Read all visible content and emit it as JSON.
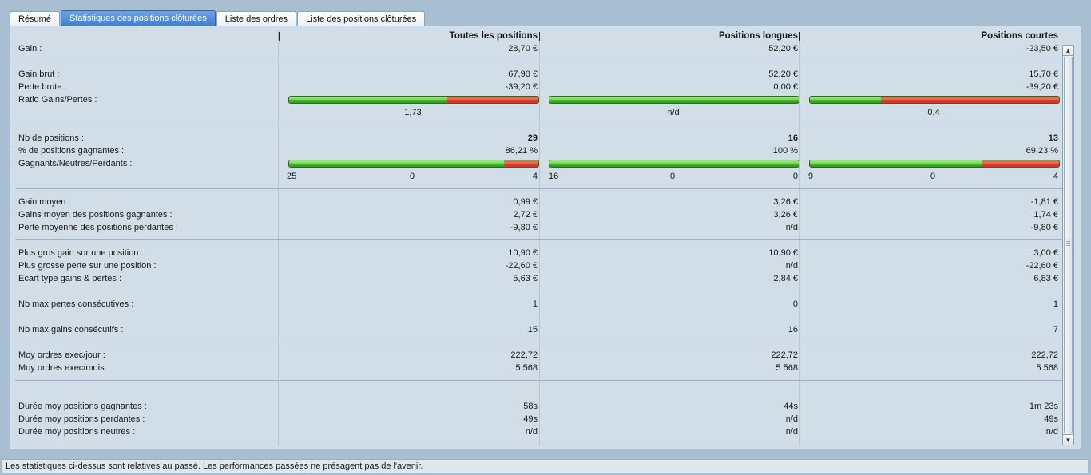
{
  "tabs": [
    {
      "label": "Résumé",
      "active": false
    },
    {
      "label": "Statistiques des positions clôturées",
      "active": true
    },
    {
      "label": "Liste des ordres",
      "active": false
    },
    {
      "label": "Liste des positions clôturées",
      "active": false
    }
  ],
  "columns": [
    "Toutes les positions",
    "Positions longues",
    "Positions courtes"
  ],
  "rows": {
    "gain": {
      "label": "Gain :",
      "v": [
        "28,70 €",
        "52,20 €",
        "-23,50 €"
      ]
    },
    "gain_brut": {
      "label": "Gain brut :",
      "v": [
        "67,90 €",
        "52,20 €",
        "15,70 €"
      ]
    },
    "perte_brute": {
      "label": "Perte brute :",
      "v": [
        "-39,20 €",
        "0,00 €",
        "-39,20 €"
      ]
    },
    "ratio": {
      "label": "Ratio Gains/Pertes :",
      "v": [
        "1,73",
        "n/d",
        "0,4"
      ]
    },
    "nb_positions": {
      "label": "Nb de positions :",
      "v": [
        "29",
        "16",
        "13"
      ]
    },
    "pct_gagnantes": {
      "label": "% de positions gagnantes :",
      "v": [
        "86,21 %",
        "100 %",
        "69,23 %"
      ]
    },
    "gnp": {
      "label": "Gagnants/Neutres/Perdants :",
      "counts": [
        {
          "g": "25",
          "n": "0",
          "p": "4"
        },
        {
          "g": "16",
          "n": "0",
          "p": "0"
        },
        {
          "g": "9",
          "n": "0",
          "p": "4"
        }
      ]
    },
    "gain_moyen": {
      "label": "Gain moyen :",
      "v": [
        "0,99 €",
        "3,26 €",
        "-1,81 €"
      ]
    },
    "gains_moy_gagnantes": {
      "label": "Gains moyen des positions gagnantes :",
      "v": [
        "2,72 €",
        "3,26 €",
        "1,74 €"
      ]
    },
    "perte_moy_perdantes": {
      "label": "Perte moyenne des positions perdantes :",
      "v": [
        "-9,80 €",
        "n/d",
        "-9,80 €"
      ]
    },
    "plus_gros_gain": {
      "label": "Plus gros gain sur une position :",
      "v": [
        "10,90 €",
        "10,90 €",
        "3,00 €"
      ]
    },
    "plus_grosse_perte": {
      "label": "Plus grosse perte sur une position :",
      "v": [
        "-22,60 €",
        "n/d",
        "-22,60 €"
      ]
    },
    "ecart_type": {
      "label": "Ecart type gains & pertes :",
      "v": [
        "5,63 €",
        "2,84 €",
        "6,83 €"
      ]
    },
    "max_pertes_consec": {
      "label": "Nb max pertes consécutives :",
      "v": [
        "1",
        "0",
        "1"
      ]
    },
    "max_gains_consec": {
      "label": "Nb max gains consécutifs :",
      "v": [
        "15",
        "16",
        "7"
      ]
    },
    "moy_ordres_jour": {
      "label": "Moy ordres exec/jour :",
      "v": [
        "222,72",
        "222,72",
        "222,72"
      ]
    },
    "moy_ordres_mois": {
      "label": "Moy ordres exec/mois",
      "v": [
        "5 568",
        "5 568",
        "5 568"
      ]
    },
    "duree_gagnantes": {
      "label": "Durée moy positions gagnantes :",
      "v": [
        "58s",
        "44s",
        "1m 23s"
      ]
    },
    "duree_perdantes": {
      "label": "Durée moy positions perdantes :",
      "v": [
        "49s",
        "n/d",
        "49s"
      ]
    },
    "duree_neutres": {
      "label": "Durée moy positions neutres :",
      "v": [
        "n/d",
        "n/d",
        "n/d"
      ]
    }
  },
  "bars": {
    "ratio_green_fraction": [
      0.634,
      1.0,
      0.286
    ],
    "gnp_green_fraction": [
      0.862,
      1.0,
      0.692
    ]
  },
  "colors": {
    "win": "#3fbf22",
    "loss": "#d63a22",
    "tab_active": "#3f7ed1"
  },
  "status_text": "Les statistiques ci-dessus sont relatives au passé. Les performances passées ne présagent pas de l'avenir."
}
